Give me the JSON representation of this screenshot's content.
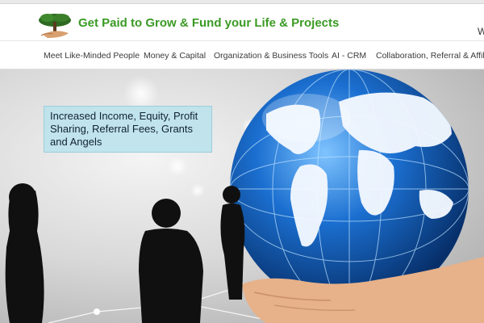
{
  "header": {
    "brand_title": "Get Paid to Grow & Fund your Life & Projects",
    "right_text": "W",
    "logo_icon": "tree-in-hand-logo",
    "brand_color": "#3a9a24"
  },
  "nav": {
    "items": [
      {
        "label": "Meet Like-Minded People"
      },
      {
        "label": "Money & Capital"
      },
      {
        "label": "Organization & Business Tools"
      },
      {
        "label": "AI - CRM"
      },
      {
        "label": "Collaboration, Referral & Affiliate"
      }
    ]
  },
  "hero": {
    "callout_text": "Increased Income, Equity, Profit Sharing, Referral Fees, Grants and Angels",
    "image_icon": "globe-in-hand-people-silhouettes",
    "globe_color": "#1b6fd0"
  }
}
